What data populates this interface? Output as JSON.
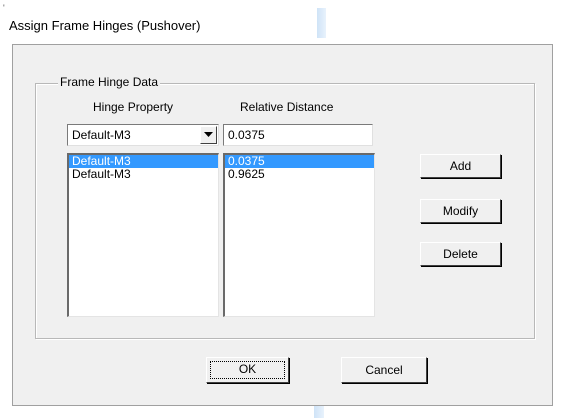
{
  "window": {
    "title": "Assign Frame Hinges (Pushover)",
    "corner_mark": "'"
  },
  "group": {
    "legend": "Frame Hinge Data",
    "col_hinge_property": "Hinge Property",
    "col_relative_distance": "Relative Distance"
  },
  "hinge_property_select": {
    "value": "Default-M3"
  },
  "relative_distance_input": {
    "value": "0.0375"
  },
  "hinge_list": [
    {
      "property": "Default-M3",
      "distance": "0.0375",
      "selected": true
    },
    {
      "property": "Default-M3",
      "distance": "0.9625",
      "selected": false
    }
  ],
  "buttons": {
    "add": "Add",
    "modify": "Modify",
    "delete": "Delete",
    "ok": "OK",
    "cancel": "Cancel"
  },
  "colors": {
    "selection": "#3399ff",
    "dialog_bg": "#f0f0f0",
    "accent_strip": "#cfe3f7"
  }
}
